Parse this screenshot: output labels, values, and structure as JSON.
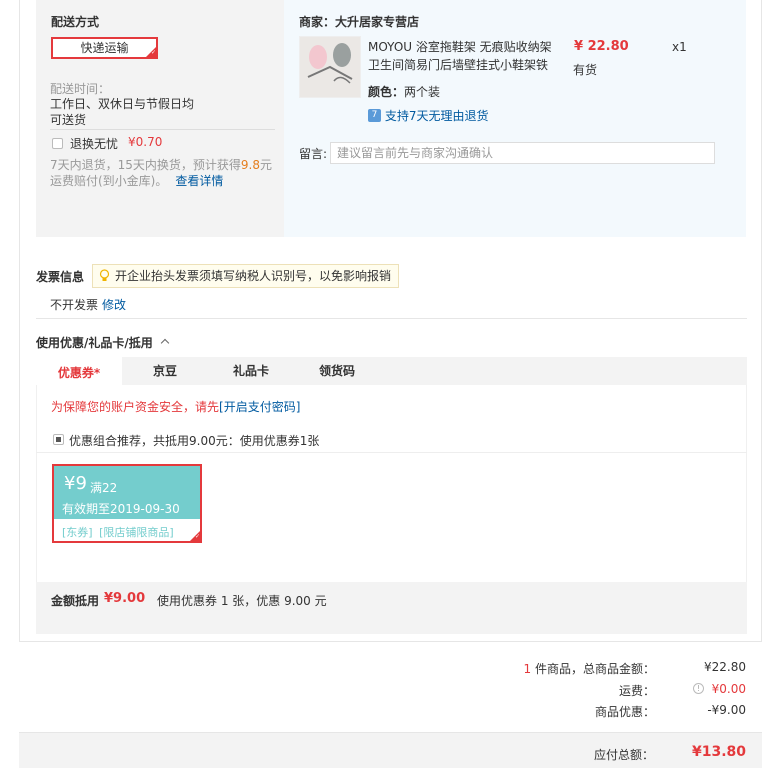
{
  "shipping": {
    "title": "配送方式",
    "method": "快递运输",
    "time_label": "配送时间：",
    "time_value_1": "工作日、双休日与节假日均",
    "time_value_2": "可送货",
    "return_label": "退换无忧",
    "return_price": "¥0.70",
    "return_desc_1a": "7天内退货，15天内换货，预计获得",
    "return_desc_1b": "9.8",
    "return_desc_1c": "元",
    "return_desc_2": "运费赔付(到小金库)。",
    "return_link": "查看详情"
  },
  "merchant": {
    "label": "商家：大升居家专营店",
    "product_name_1": "MOYOU 浴室拖鞋架 无痕贴收纳架",
    "product_name_2": "卫生间简易门后墙壁挂式小鞋架铁",
    "price": "¥ 22.80",
    "qty": "x1",
    "stock": "有货",
    "color_label": "颜色：",
    "color_value": "两个装",
    "return_badge": "7",
    "return_policy": "支持7天无理由退货",
    "note_label": "留言:",
    "note_placeholder": "建议留言前先与商家沟通确认"
  },
  "invoice": {
    "title": "发票信息",
    "tip": "开企业抬头发票须填写纳税人识别号，以免影响报销",
    "value": "不开发票",
    "modify": "修改"
  },
  "discount": {
    "title": "使用优惠/礼品卡/抵用",
    "tabs": [
      "优惠券*",
      "京豆",
      "礼品卡",
      "领货码"
    ],
    "security_text": "为保障您的账户资金安全，请先",
    "security_link": "[开启支付密码]",
    "combo_text": "优惠组合推荐，共抵用9.00元：使用优惠券1张",
    "coupon": {
      "amount": "¥9",
      "condition": "满22",
      "validity": "有效期至2019-09-30",
      "tag_1": "[东券]",
      "tag_2": "[限店铺限商品]"
    },
    "summary_label": "金额抵用",
    "summary_amount": "¥9.00",
    "summary_desc": "使用优惠券 1 张，优惠 9.00 元"
  },
  "totals": {
    "count": "1",
    "goods_label": " 件商品，总商品金额：",
    "goods_amount": "¥22.80",
    "shipping_label": "运费：",
    "shipping_amount": "¥0.00",
    "discount_label": "商品优惠：",
    "discount_amount": "-¥9.00",
    "payable_label": "应付总额：",
    "payable_amount": "¥13.80"
  },
  "colors": {
    "accent": "#e4393c",
    "link": "#005aa0",
    "coupon_teal": "#74cdcd"
  }
}
